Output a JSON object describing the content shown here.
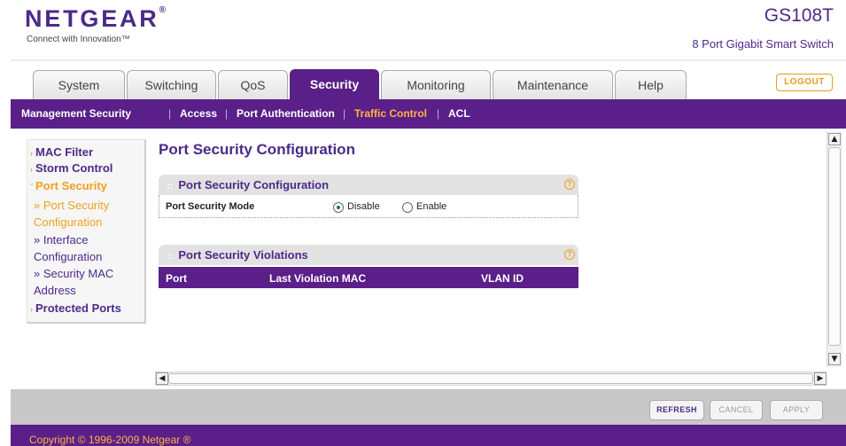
{
  "header": {
    "brand": "NETGEAR",
    "tagline": "Connect with Innovation™",
    "model": "GS108T",
    "subtitle": "8 Port Gigabit Smart Switch",
    "logout_label": "LOGOUT"
  },
  "tabs": [
    {
      "label": "System"
    },
    {
      "label": "Switching"
    },
    {
      "label": "QoS"
    },
    {
      "label": "Security"
    },
    {
      "label": "Monitoring"
    },
    {
      "label": "Maintenance"
    },
    {
      "label": "Help"
    }
  ],
  "active_tab": "Security",
  "subnav": [
    {
      "label": "Management Security"
    },
    {
      "label": "Access"
    },
    {
      "label": "Port Authentication"
    },
    {
      "label": "Traffic Control"
    },
    {
      "label": "ACL"
    }
  ],
  "subnav_separator": "|",
  "sidebar": {
    "items": [
      {
        "label": "MAC Filter"
      },
      {
        "label": "Storm Control"
      },
      {
        "label": "Port Security"
      },
      {
        "label": "Protected Ports"
      }
    ],
    "port_security_sub": [
      {
        "label": "Port Security Configuration"
      },
      {
        "label": "Interface Configuration"
      },
      {
        "label": "Security MAC Address"
      }
    ]
  },
  "main": {
    "title": "Port Security Configuration",
    "config_panel": {
      "title": "Port Security Configuration",
      "mode_label": "Port Security Mode",
      "options": [
        {
          "label": "Disable",
          "selected": true
        },
        {
          "label": "Enable",
          "selected": false
        }
      ]
    },
    "violations_panel": {
      "title": "Port Security Violations",
      "columns": [
        "Port",
        "Last Violation MAC",
        "VLAN ID"
      ],
      "rows": []
    }
  },
  "footer": {
    "refresh_label": "REFRESH",
    "cancel_label": "CANCEL",
    "apply_label": "APPLY",
    "copyright": "Copyright © 1996-2009 Netgear ®"
  },
  "colors": {
    "brand_purple": "#5a1f88",
    "accent_orange": "#f0a020",
    "text_purple": "#4b2a8a"
  }
}
